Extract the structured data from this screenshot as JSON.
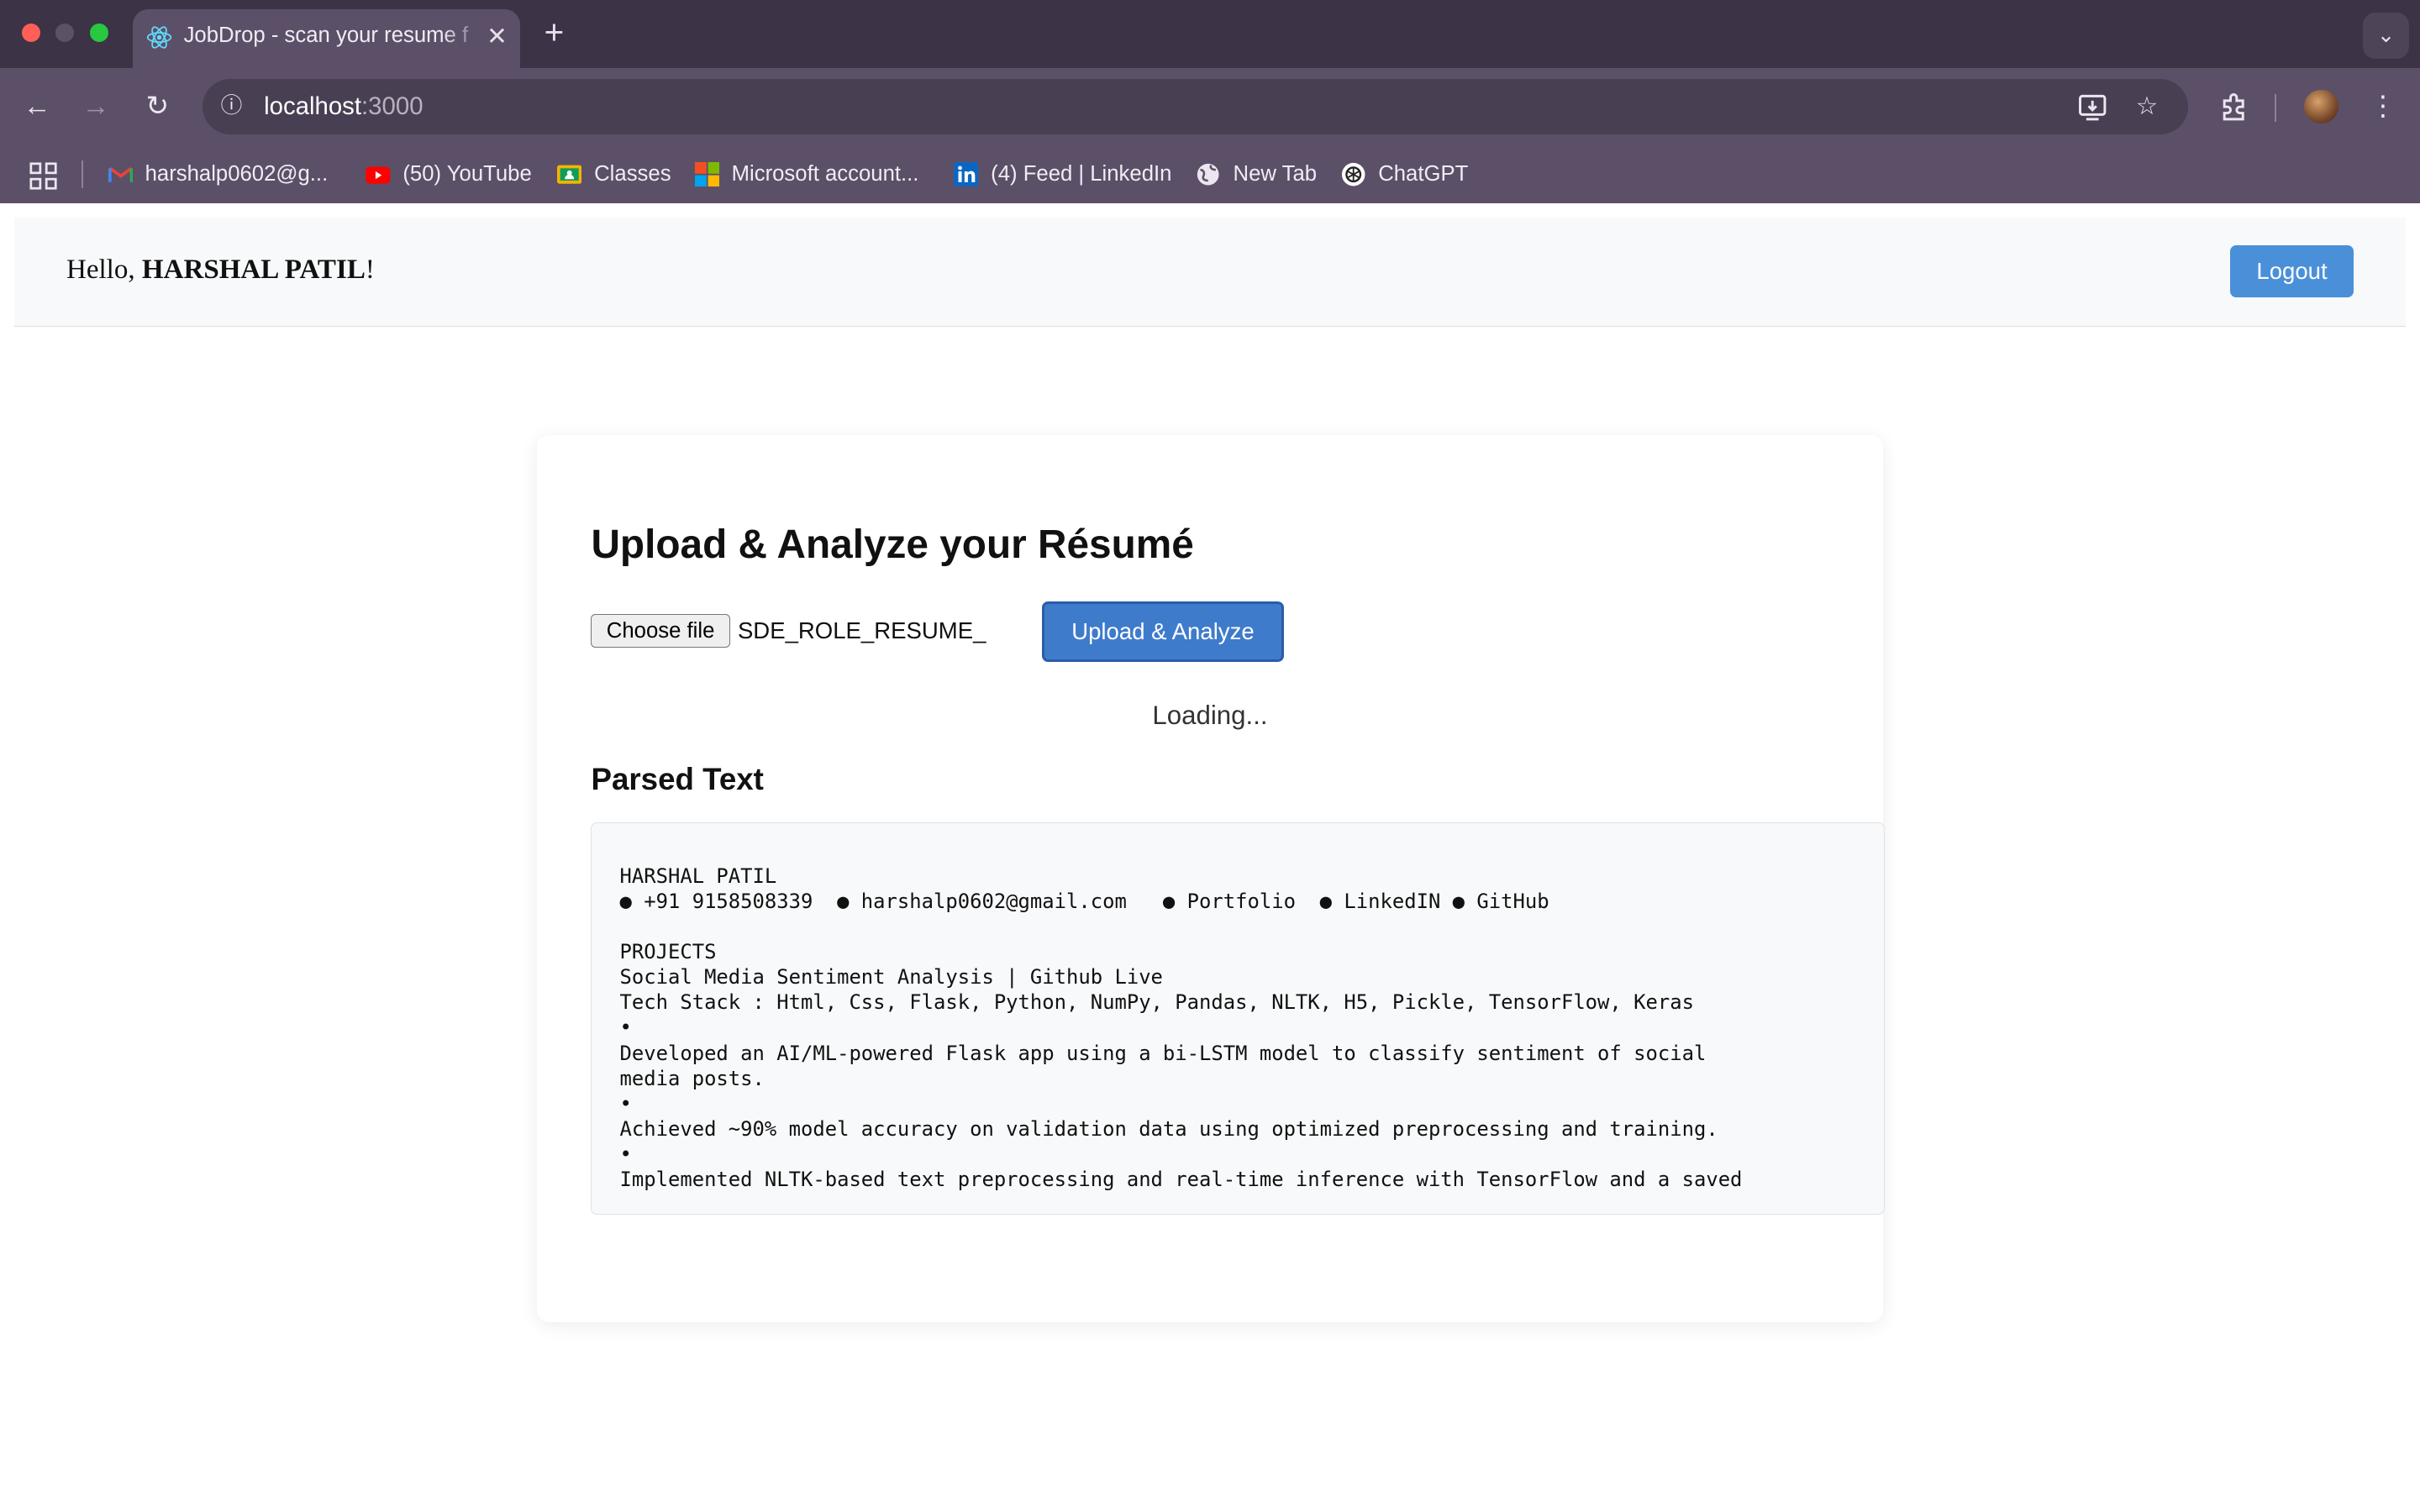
{
  "browser": {
    "tab_title": "JobDrop - scan your resume f",
    "url_host": "localhost",
    "url_port": ":3000",
    "bookmarks": [
      {
        "label": "harshalp0602@g...",
        "icon": "gmail-icon"
      },
      {
        "label": "(50) YouTube",
        "icon": "youtube-icon"
      },
      {
        "label": "Classes",
        "icon": "classroom-icon"
      },
      {
        "label": "Microsoft account...",
        "icon": "microsoft-icon"
      },
      {
        "label": "(4) Feed | LinkedIn",
        "icon": "linkedin-icon"
      },
      {
        "label": "New Tab",
        "icon": "globe-icon"
      },
      {
        "label": "ChatGPT",
        "icon": "chatgpt-icon"
      }
    ]
  },
  "header": {
    "greeting_prefix": "Hello, ",
    "user_name": "HARSHAL PATIL",
    "greeting_suffix": "!",
    "logout_label": "Logout"
  },
  "upload": {
    "title": "Upload & Analyze your Résumé",
    "choose_file_label": "Choose file",
    "file_name": "SDE_ROLE_RESUME_",
    "analyze_label": "Upload & Analyze",
    "status": "Loading..."
  },
  "parsed": {
    "title": "Parsed Text",
    "text": "HARSHAL PATIL\n● +91 9158508339  ● harshalp0602@gmail.com   ● Portfolio  ● LinkedIN ● GitHub\n\nPROJECTS\nSocial Media Sentiment Analysis | Github Live\nTech Stack : Html, Css, Flask, Python, NumPy, Pandas, NLTK, H5, Pickle, TensorFlow, Keras\n•\nDeveloped an AI/ML-powered Flask app using a bi-LSTM model to classify sentiment of social\nmedia posts.\n•\nAchieved ~90% model accuracy on validation data using optimized preprocessing and training.\n•\nImplemented NLTK-based text preprocessing and real-time inference with TensorFlow and a saved"
  },
  "colors": {
    "tabstrip": "#3c3347",
    "toolbar": "#5c5068",
    "primary_button": "#4a90d9",
    "analyze_button": "#3f7bcb"
  }
}
